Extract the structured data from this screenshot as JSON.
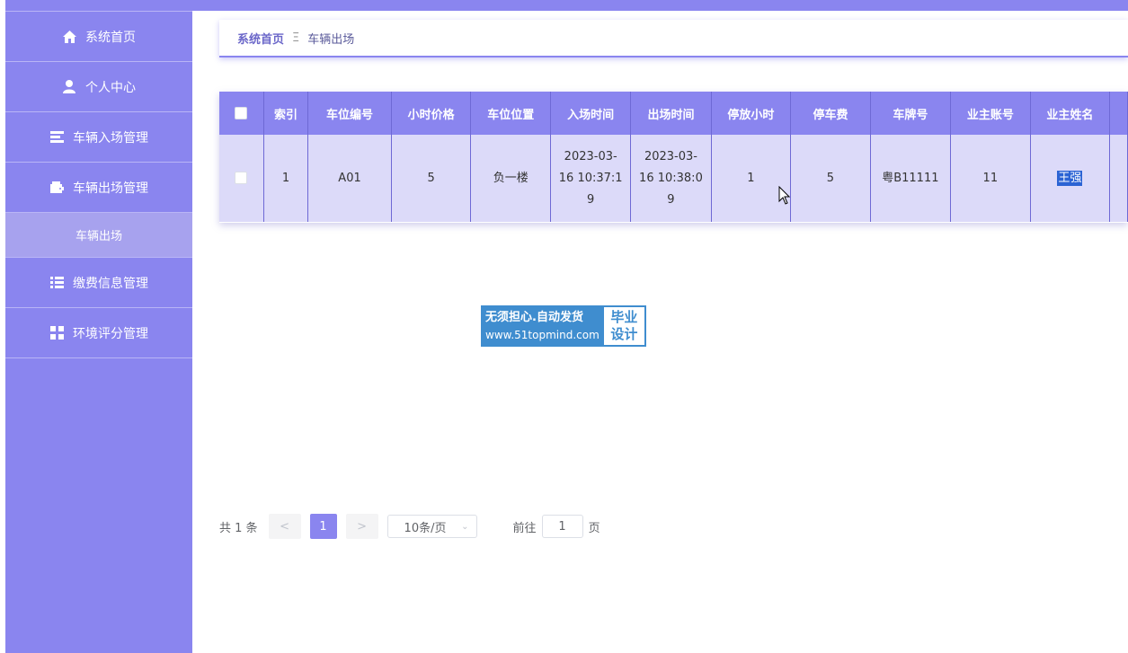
{
  "sidebar": {
    "items": [
      {
        "label": "系统首页",
        "icon": "home-icon"
      },
      {
        "label": "个人中心",
        "icon": "user-icon"
      },
      {
        "label": "车辆入场管理",
        "icon": "list-icon"
      },
      {
        "label": "车辆出场管理",
        "icon": "wallet-icon"
      },
      {
        "label": "车辆出场",
        "icon": ""
      },
      {
        "label": "缴费信息管理",
        "icon": "list-icon"
      },
      {
        "label": "环境评分管理",
        "icon": "grid-icon"
      }
    ]
  },
  "breadcrumb": {
    "home": "系统首页",
    "separator": "Ξ",
    "current": "车辆出场"
  },
  "table": {
    "headers": [
      "索引",
      "车位编号",
      "小时价格",
      "车位位置",
      "入场时间",
      "出场时间",
      "停放小时",
      "停车费",
      "车牌号",
      "业主账号",
      "业主姓名"
    ],
    "rows": [
      {
        "index": "1",
        "space_no": "A01",
        "hour_price": "5",
        "location": "负一楼",
        "entry_time_1": "2023-03-",
        "entry_time_2": "16 10:37:1",
        "entry_time_3": "9",
        "exit_time_1": "2023-03-",
        "exit_time_2": "16 10:38:0",
        "exit_time_3": "9",
        "hours": "1",
        "fee": "5",
        "plate": "粤B11111",
        "account": "11",
        "owner_name": "王强"
      }
    ]
  },
  "watermark": {
    "slogan": "无须担心.自动发货",
    "url": "www.51topmind.com",
    "tag1": "毕业",
    "tag2": "设计"
  },
  "pagination": {
    "total": "共 1 条",
    "prev": "<",
    "current_page": "1",
    "next": ">",
    "page_size": "10条/页",
    "goto_label": "前往",
    "goto_value": "1",
    "page_suffix": "页"
  },
  "colors": {
    "accent": "#8a85ef",
    "row_bg": "#dcdaf9",
    "selection": "#2b63d4"
  }
}
